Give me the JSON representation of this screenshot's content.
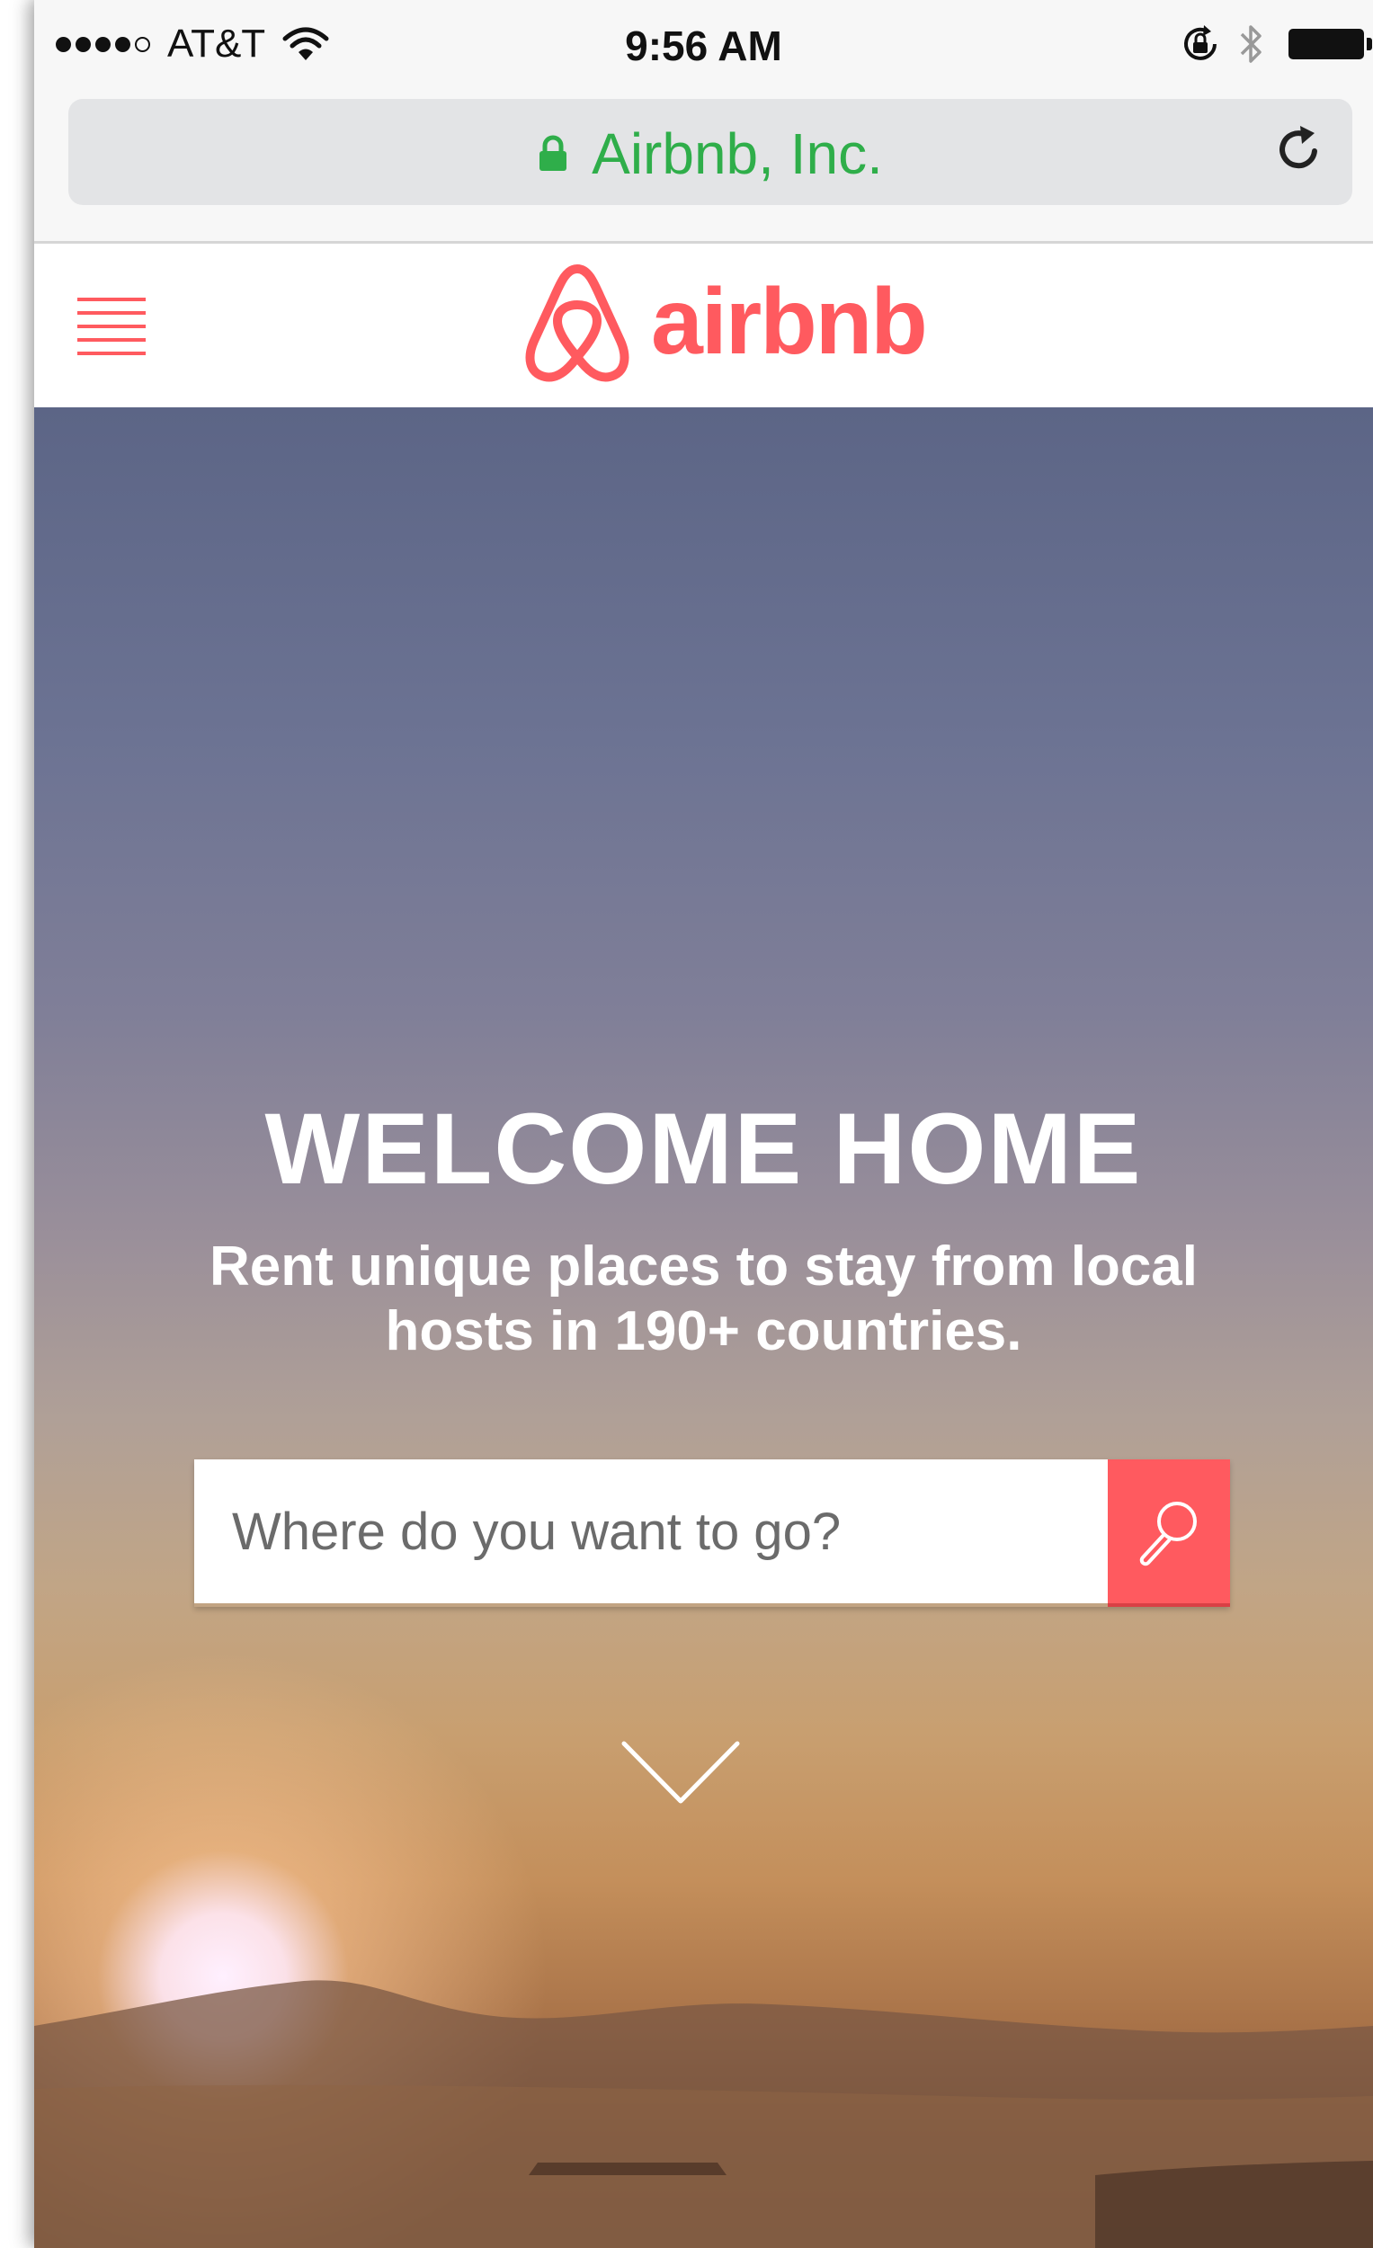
{
  "status_bar": {
    "carrier": "AT&T",
    "time": "9:56 AM",
    "signal_bars": 4,
    "signal_total": 5
  },
  "address_bar": {
    "site_name": "Airbnb, Inc."
  },
  "header": {
    "logo_text": "airbnb"
  },
  "hero": {
    "title": "WELCOME HOME",
    "subtitle": "Rent unique places to stay from local hosts in 190+ countries.",
    "search_placeholder": "Where do you want to go?"
  },
  "colors": {
    "brand": "#ff5a5f",
    "secure": "#2fae4a"
  },
  "icons": {
    "menu": "hamburger-menu-icon",
    "search": "magnifier-icon",
    "reload": "reload-icon",
    "scroll": "chevron-down-icon"
  }
}
